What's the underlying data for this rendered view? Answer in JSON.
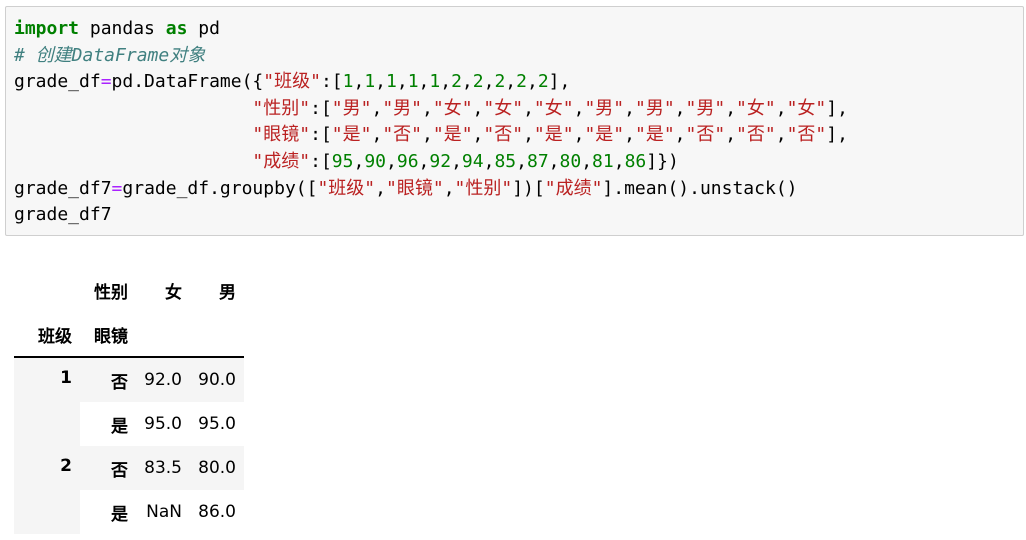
{
  "code": {
    "lines": [
      [
        {
          "t": "import",
          "c": "kw"
        },
        {
          "t": " pandas ",
          "c": "pl"
        },
        {
          "t": "as",
          "c": "kw"
        },
        {
          "t": " pd",
          "c": "pl"
        }
      ],
      [
        {
          "t": "# 创建DataFrame对象",
          "c": "cm"
        }
      ],
      [
        {
          "t": "grade_df",
          "c": "pl"
        },
        {
          "t": "=",
          "c": "op"
        },
        {
          "t": "pd.DataFrame({",
          "c": "pl"
        },
        {
          "t": "\"班级\"",
          "c": "st"
        },
        {
          "t": ":[",
          "c": "pl"
        },
        {
          "t": "1",
          "c": "nm"
        },
        {
          "t": ",",
          "c": "pl"
        },
        {
          "t": "1",
          "c": "nm"
        },
        {
          "t": ",",
          "c": "pl"
        },
        {
          "t": "1",
          "c": "nm"
        },
        {
          "t": ",",
          "c": "pl"
        },
        {
          "t": "1",
          "c": "nm"
        },
        {
          "t": ",",
          "c": "pl"
        },
        {
          "t": "1",
          "c": "nm"
        },
        {
          "t": ",",
          "c": "pl"
        },
        {
          "t": "2",
          "c": "nm"
        },
        {
          "t": ",",
          "c": "pl"
        },
        {
          "t": "2",
          "c": "nm"
        },
        {
          "t": ",",
          "c": "pl"
        },
        {
          "t": "2",
          "c": "nm"
        },
        {
          "t": ",",
          "c": "pl"
        },
        {
          "t": "2",
          "c": "nm"
        },
        {
          "t": ",",
          "c": "pl"
        },
        {
          "t": "2",
          "c": "nm"
        },
        {
          "t": "],",
          "c": "pl"
        }
      ],
      [
        {
          "t": "                      ",
          "c": "pl"
        },
        {
          "t": "\"性别\"",
          "c": "st"
        },
        {
          "t": ":[",
          "c": "pl"
        },
        {
          "t": "\"男\"",
          "c": "st"
        },
        {
          "t": ",",
          "c": "pl"
        },
        {
          "t": "\"男\"",
          "c": "st"
        },
        {
          "t": ",",
          "c": "pl"
        },
        {
          "t": "\"女\"",
          "c": "st"
        },
        {
          "t": ",",
          "c": "pl"
        },
        {
          "t": "\"女\"",
          "c": "st"
        },
        {
          "t": ",",
          "c": "pl"
        },
        {
          "t": "\"女\"",
          "c": "st"
        },
        {
          "t": ",",
          "c": "pl"
        },
        {
          "t": "\"男\"",
          "c": "st"
        },
        {
          "t": ",",
          "c": "pl"
        },
        {
          "t": "\"男\"",
          "c": "st"
        },
        {
          "t": ",",
          "c": "pl"
        },
        {
          "t": "\"男\"",
          "c": "st"
        },
        {
          "t": ",",
          "c": "pl"
        },
        {
          "t": "\"女\"",
          "c": "st"
        },
        {
          "t": ",",
          "c": "pl"
        },
        {
          "t": "\"女\"",
          "c": "st"
        },
        {
          "t": "],",
          "c": "pl"
        }
      ],
      [
        {
          "t": "                      ",
          "c": "pl"
        },
        {
          "t": "\"眼镜\"",
          "c": "st"
        },
        {
          "t": ":[",
          "c": "pl"
        },
        {
          "t": "\"是\"",
          "c": "st"
        },
        {
          "t": ",",
          "c": "pl"
        },
        {
          "t": "\"否\"",
          "c": "st"
        },
        {
          "t": ",",
          "c": "pl"
        },
        {
          "t": "\"是\"",
          "c": "st"
        },
        {
          "t": ",",
          "c": "pl"
        },
        {
          "t": "\"否\"",
          "c": "st"
        },
        {
          "t": ",",
          "c": "pl"
        },
        {
          "t": "\"是\"",
          "c": "st"
        },
        {
          "t": ",",
          "c": "pl"
        },
        {
          "t": "\"是\"",
          "c": "st"
        },
        {
          "t": ",",
          "c": "pl"
        },
        {
          "t": "\"是\"",
          "c": "st"
        },
        {
          "t": ",",
          "c": "pl"
        },
        {
          "t": "\"否\"",
          "c": "st"
        },
        {
          "t": ",",
          "c": "pl"
        },
        {
          "t": "\"否\"",
          "c": "st"
        },
        {
          "t": ",",
          "c": "pl"
        },
        {
          "t": "\"否\"",
          "c": "st"
        },
        {
          "t": "],",
          "c": "pl"
        }
      ],
      [
        {
          "t": "                      ",
          "c": "pl"
        },
        {
          "t": "\"成绩\"",
          "c": "st"
        },
        {
          "t": ":[",
          "c": "pl"
        },
        {
          "t": "95",
          "c": "nm"
        },
        {
          "t": ",",
          "c": "pl"
        },
        {
          "t": "90",
          "c": "nm"
        },
        {
          "t": ",",
          "c": "pl"
        },
        {
          "t": "96",
          "c": "nm"
        },
        {
          "t": ",",
          "c": "pl"
        },
        {
          "t": "92",
          "c": "nm"
        },
        {
          "t": ",",
          "c": "pl"
        },
        {
          "t": "94",
          "c": "nm"
        },
        {
          "t": ",",
          "c": "pl"
        },
        {
          "t": "85",
          "c": "nm"
        },
        {
          "t": ",",
          "c": "pl"
        },
        {
          "t": "87",
          "c": "nm"
        },
        {
          "t": ",",
          "c": "pl"
        },
        {
          "t": "80",
          "c": "nm"
        },
        {
          "t": ",",
          "c": "pl"
        },
        {
          "t": "81",
          "c": "nm"
        },
        {
          "t": ",",
          "c": "pl"
        },
        {
          "t": "86",
          "c": "nm"
        },
        {
          "t": "]})",
          "c": "pl"
        }
      ],
      [
        {
          "t": "grade_df7",
          "c": "pl"
        },
        {
          "t": "=",
          "c": "op"
        },
        {
          "t": "grade_df.groupby([",
          "c": "pl"
        },
        {
          "t": "\"班级\"",
          "c": "st"
        },
        {
          "t": ",",
          "c": "pl"
        },
        {
          "t": "\"眼镜\"",
          "c": "st"
        },
        {
          "t": ",",
          "c": "pl"
        },
        {
          "t": "\"性别\"",
          "c": "st"
        },
        {
          "t": "])[",
          "c": "pl"
        },
        {
          "t": "\"成绩\"",
          "c": "st"
        },
        {
          "t": "].mean().unstack()",
          "c": "pl"
        }
      ],
      [
        {
          "t": "grade_df7",
          "c": "pl"
        }
      ]
    ]
  },
  "colors": {
    "keyword": "#008000",
    "comment": "#408080",
    "string": "#ba2121",
    "number": "#008000",
    "operator": "#aa22ff"
  },
  "output_table": {
    "columns_name": "性别",
    "columns": [
      "女",
      "男"
    ],
    "index_names": [
      "班级",
      "眼镜"
    ],
    "rows": [
      {
        "lvl0": "1",
        "lvl1": "否",
        "values": [
          "92.0",
          "90.0"
        ]
      },
      {
        "lvl0": "",
        "lvl1": "是",
        "values": [
          "95.0",
          "95.0"
        ]
      },
      {
        "lvl0": "2",
        "lvl1": "否",
        "values": [
          "83.5",
          "80.0"
        ]
      },
      {
        "lvl0": "",
        "lvl1": "是",
        "values": [
          "NaN",
          "86.0"
        ]
      }
    ]
  }
}
